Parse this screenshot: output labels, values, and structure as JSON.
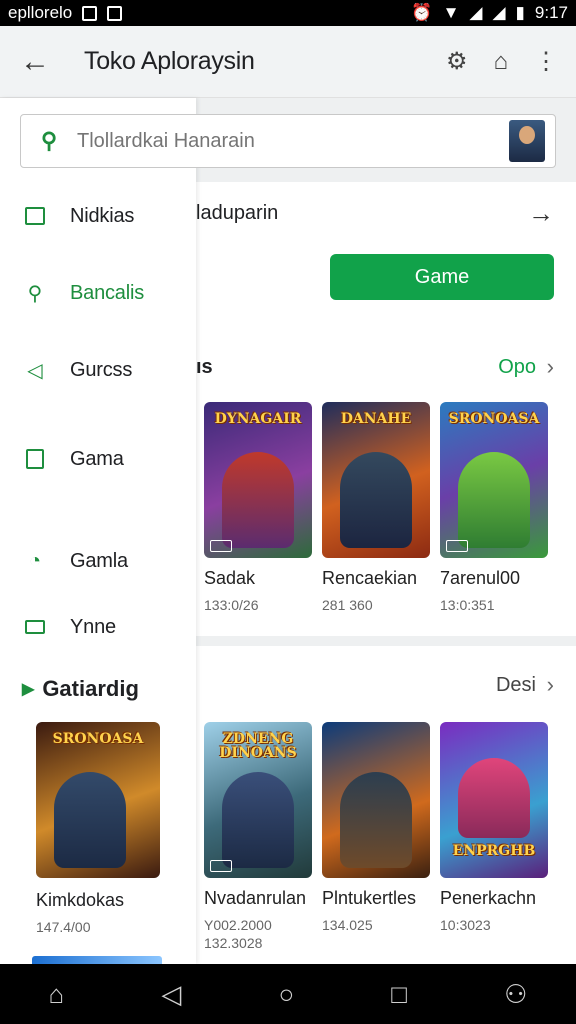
{
  "status": {
    "carrier": "epllorelo",
    "time": "9:17"
  },
  "appbar": {
    "title": "Toko Aplorаysin"
  },
  "search": {
    "placeholder": "Tlollardkai Hanarain"
  },
  "main": {
    "link_text": "ladupаrin",
    "primary_button": "Game",
    "section1": {
      "title": "ıs",
      "more": "Opo",
      "cards": [
        {
          "art": "DYNAGAIR",
          "name": "Sadak",
          "meta": "133:0/26"
        },
        {
          "art": "DANAHE",
          "name": "Rencaekian",
          "meta": "281 360"
        },
        {
          "art": "SRONOASA",
          "name": "7arenul00",
          "meta": "13:0:351"
        }
      ]
    },
    "section2": {
      "more": "Desi",
      "cards": [
        {
          "art": "ZDNENG DINOANS",
          "name": "Nvadanrulan",
          "meta": "Y002.2000",
          "meta2": "132.3028"
        },
        {
          "art": "",
          "name": "Plntukеrtles",
          "meta": "134.025"
        },
        {
          "art": "ENPRGHB",
          "name": "Penerkachn",
          "meta": "10:3023"
        }
      ]
    }
  },
  "drawer": {
    "items": [
      {
        "label": "Nidkias",
        "icon": "box-icon"
      },
      {
        "label": "Bancalis",
        "icon": "search-icon"
      },
      {
        "label": "Gurcss",
        "icon": "megaphone-icon"
      },
      {
        "label": "Gama",
        "icon": "book-icon"
      },
      {
        "label": "Gamla",
        "icon": "gauge-icon"
      },
      {
        "label": "Ynne",
        "icon": "ticket-icon"
      }
    ],
    "section_title": "Gatiardig",
    "card": {
      "art": "SRONOASA",
      "name": "Kimkdokas",
      "meta": "147.4/00"
    }
  },
  "colors": {
    "accent": "#1e8e3e",
    "button": "#11a24a"
  }
}
